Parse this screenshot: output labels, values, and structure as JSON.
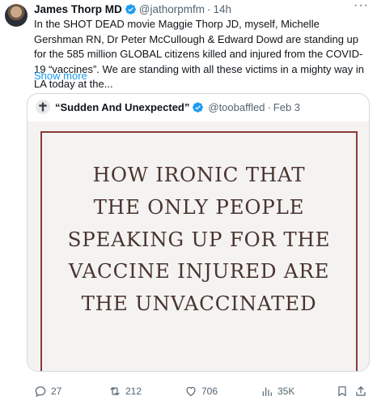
{
  "post": {
    "author_name": "James Thorp MD",
    "author_handle": "@jathorpmfm",
    "separator": "·",
    "time": "14h",
    "more": "···",
    "text": "In the SHOT DEAD movie Maggie Thorp JD, myself, Michelle Gershman RN, Dr Peter McCullough & Edward Dowd are standing up for the 585 million GLOBAL citizens killed and injured from the COVID-19 “vaccines”. We are standing with all these victims in a mighty way in LA today at the...",
    "show_more": "Show more"
  },
  "quote": {
    "author_name": "“Sudden And Unexpected”",
    "author_handle": "@toobaffled",
    "separator": "·",
    "date": "Feb 3",
    "image_lines": [
      "HOW IRONIC THAT",
      "THE ONLY PEOPLE",
      "SPEAKING UP FOR THE",
      "VACCINE INJURED ARE",
      "THE UNVACCINATED"
    ]
  },
  "actions": {
    "replies": "27",
    "reposts": "212",
    "likes": "706",
    "views": "35K"
  },
  "colors": {
    "accent": "#1d9bf0",
    "secondary_text": "#536471",
    "frame_border": "#8b3a3a",
    "meme_text": "#4a342e"
  },
  "icons": [
    "verified-badge-icon",
    "cross-icon",
    "reply-icon",
    "repost-icon",
    "like-icon",
    "views-icon",
    "bookmark-icon",
    "share-icon"
  ]
}
